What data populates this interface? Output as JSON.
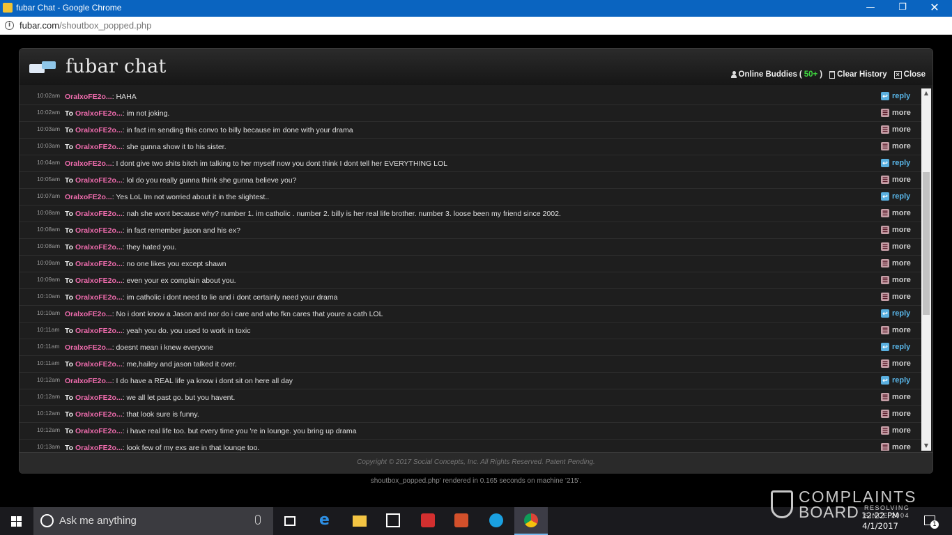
{
  "window": {
    "title": "fubar Chat - Google Chrome",
    "minimize": "—",
    "maximize": "❐",
    "close": "✕"
  },
  "address": {
    "info_icon": "i",
    "host": "fubar.com",
    "path": "/shoutbox_popped.php"
  },
  "chat": {
    "logo_text": "fubar chat",
    "header_links": {
      "online_buddies_label": "Online Buddies",
      "online_buddies_open": " (",
      "online_buddies_count": "50+",
      "online_buddies_close": ")",
      "clear_history": "Clear History",
      "close": "Close"
    },
    "messages": [
      {
        "time": "10:02am",
        "prefix": "",
        "user": "OralxoFE2o...",
        "text": ": HAHA",
        "action": "reply"
      },
      {
        "time": "10:02am",
        "prefix": "To ",
        "user": "OralxoFE2o...",
        "text": ": im not joking.",
        "action": "more"
      },
      {
        "time": "10:03am",
        "prefix": "To ",
        "user": "OralxoFE2o...",
        "text": ": in fact im sending this convo to billy because im done with your drama",
        "action": "more"
      },
      {
        "time": "10:03am",
        "prefix": "To ",
        "user": "OralxoFE2o...",
        "text": ": she gunna show it to his sister.",
        "action": "more"
      },
      {
        "time": "10:04am",
        "prefix": "",
        "user": "OralxoFE2o...",
        "text": ": I dont give two shits bitch im talking to her myself now you dont think I dont tell her EVERYTHING LOL",
        "action": "reply"
      },
      {
        "time": "10:05am",
        "prefix": "To ",
        "user": "OralxoFE2o...",
        "text": ": lol do you really gunna think she gunna believe you?",
        "action": "more"
      },
      {
        "time": "10:07am",
        "prefix": "",
        "user": "OralxoFE2o...",
        "text": ": Yes LoL Im not worried about it in the slightest..",
        "action": "reply"
      },
      {
        "time": "10:08am",
        "prefix": "To ",
        "user": "OralxoFE2o...",
        "text": ": nah she wont because why? number 1. im catholic . number 2. billy is her real life brother. number 3. loose been my friend since 2002.",
        "action": "more"
      },
      {
        "time": "10:08am",
        "prefix": "To ",
        "user": "OralxoFE2o...",
        "text": ": in fact remember jason and his ex?",
        "action": "more"
      },
      {
        "time": "10:08am",
        "prefix": "To ",
        "user": "OralxoFE2o...",
        "text": ": they hated you.",
        "action": "more"
      },
      {
        "time": "10:09am",
        "prefix": "To ",
        "user": "OralxoFE2o...",
        "text": ": no one likes you except shawn",
        "action": "more"
      },
      {
        "time": "10:09am",
        "prefix": "To ",
        "user": "OralxoFE2o...",
        "text": ": even your ex complain about you.",
        "action": "more"
      },
      {
        "time": "10:10am",
        "prefix": "To ",
        "user": "OralxoFE2o...",
        "text": ": im catholic i dont need to lie and i dont certainly need your drama",
        "action": "more"
      },
      {
        "time": "10:10am",
        "prefix": "",
        "user": "OralxoFE2o...",
        "text": ": No i dont know a Jason and nor do i care and who fkn cares that youre a cath LOL",
        "action": "reply"
      },
      {
        "time": "10:11am",
        "prefix": "To ",
        "user": "OralxoFE2o...",
        "text": ": yeah you do. you used to work in toxic",
        "action": "more"
      },
      {
        "time": "10:11am",
        "prefix": "",
        "user": "OralxoFE2o...",
        "text": ": doesnt mean i knew everyone",
        "action": "reply"
      },
      {
        "time": "10:11am",
        "prefix": "To ",
        "user": "OralxoFE2o...",
        "text": ": me,hailey and jason talked it over.",
        "action": "more"
      },
      {
        "time": "10:12am",
        "prefix": "",
        "user": "OralxoFE2o...",
        "text": ": I do have a REAL life ya know i dont sit on here all day",
        "action": "reply"
      },
      {
        "time": "10:12am",
        "prefix": "To ",
        "user": "OralxoFE2o...",
        "text": ": we all let past go. but you havent.",
        "action": "more"
      },
      {
        "time": "10:12am",
        "prefix": "To ",
        "user": "OralxoFE2o...",
        "text": ": that look sure is funny.",
        "action": "more"
      },
      {
        "time": "10:12am",
        "prefix": "To ",
        "user": "OralxoFE2o...",
        "text": ": i have real life too. but every time you 're in lounge. you bring up drama",
        "action": "more"
      },
      {
        "time": "10:13am",
        "prefix": "To ",
        "user": "OralxoFE2o...",
        "text": ": look few of my exs are in that lounge too.",
        "action": "more"
      }
    ],
    "action_labels": {
      "reply": "reply",
      "more": "more"
    },
    "footer": "Copyright © 2017 Social Concepts, Inc. All Rights Reserved. Patent Pending.",
    "render_note": "shoutbox_popped.php' rendered in 0.165 seconds on machine '215'."
  },
  "taskbar": {
    "search_placeholder": "Ask me anything",
    "time": "12:22 PM",
    "date": "4/1/2017",
    "notification_count": "1",
    "apps": [
      "task-view-icon",
      "edge-icon",
      "file-explorer-icon",
      "store-icon",
      "app-red-icon",
      "app-orange-icon",
      "skype-icon",
      "chrome-icon"
    ]
  },
  "watermark": {
    "line1": "COMPLAINTS",
    "line2": "BOARD",
    "tagline1": "RESOLVING",
    "tagline2": "SINCE 2004"
  },
  "colors": {
    "titlebar": "#0a64c0",
    "username": "#f06cae",
    "reply": "#58b4e6",
    "online_count": "#3fd63f"
  }
}
